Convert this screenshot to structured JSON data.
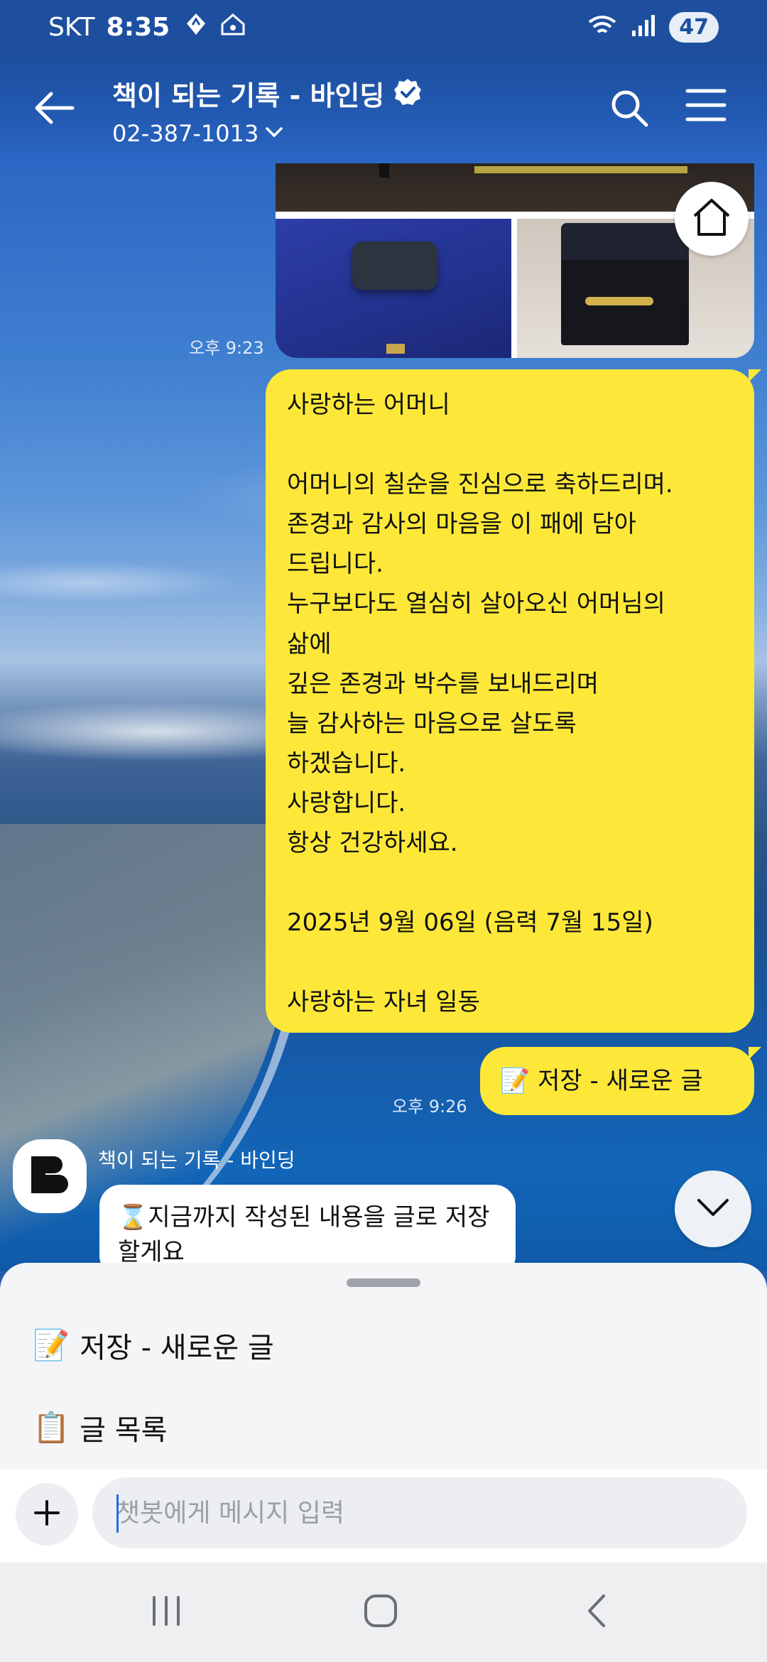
{
  "status_bar": {
    "carrier": "SKT",
    "time": "8:35",
    "battery": "47",
    "icons": [
      "navigation-icon",
      "home-wifi-icon",
      "wifi-icon",
      "signal-icon"
    ]
  },
  "header": {
    "title": "책이 되는 기록 - 바인딩",
    "phone": "02-387-1013",
    "icons": [
      "back-arrow-icon",
      "verified-badge-icon",
      "chevron-down-icon",
      "search-icon",
      "menu-icon"
    ]
  },
  "messages": {
    "image_time": "오후 9:23",
    "letter_text": "사랑하는 어머니\n\n어머니의 칠순을 진심으로 축하드리며.\n존경과 감사의 마음을 이 패에 담아\n드립니다.\n누구보다도 열심히 살아오신 어머님의\n삶에\n깊은 존경과 박수를 보내드리며\n늘 감사하는 마음으로 살도록\n하겠습니다.\n사랑합니다.\n항상 건강하세요.\n\n2025년 9월 06일 (음력 7월 15일)\n\n사랑하는 자녀 일동",
    "save_text": "📝 저장 - 새로운 글",
    "save_time": "오후 9:26",
    "bot_name": "책이 되는 기록 - 바인딩",
    "bot_text": "⌛지금까지 작성된 내용을 글로 저장할게요"
  },
  "quick_replies": {
    "item1_icon": "📝",
    "item1_label": "저장 - 새로운 글",
    "item2_icon": "📋",
    "item2_label": "글 목록"
  },
  "input": {
    "placeholder": "챗봇에게 메시지 입력"
  },
  "colors": {
    "bubble_yellow": "#fde83a",
    "header_blue": "#1d4f9e",
    "sheet_bg": "#f4f5f7"
  }
}
